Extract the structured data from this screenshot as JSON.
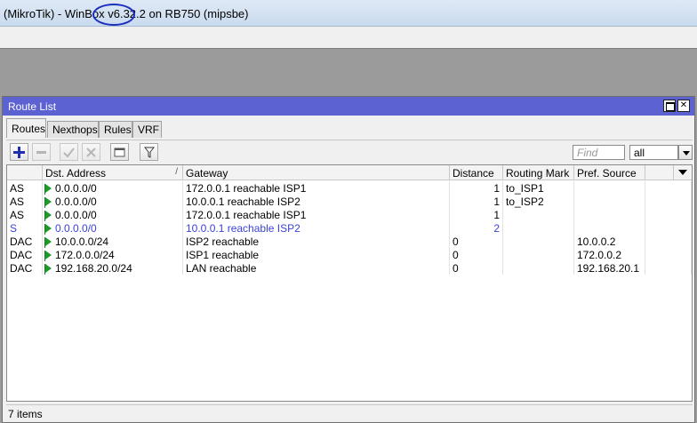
{
  "app": {
    "window_title": "(MikroTik) - WinBox v6.32.2 on RB750 (mipsbe)"
  },
  "route_list": {
    "title": "Route List",
    "tabs": [
      {
        "label": "Routes",
        "active": true
      },
      {
        "label": "Nexthops",
        "active": false
      },
      {
        "label": "Rules",
        "active": false
      },
      {
        "label": "VRF",
        "active": false
      }
    ],
    "toolbar": {
      "add_icon": "plus-icon",
      "remove_icon": "minus-icon",
      "enable_icon": "check-icon",
      "disable_icon": "x-icon",
      "comment_icon": "comment-icon",
      "filter_icon": "filter-icon",
      "find_placeholder": "Find",
      "filter_value": "all"
    },
    "columns": {
      "flags": "",
      "dst_address": "Dst. Address",
      "sort_indicator": "/",
      "gateway": "Gateway",
      "distance": "Distance",
      "routing_mark": "Routing Mark",
      "pref_source": "Pref. Source"
    },
    "rows": [
      {
        "flags": "AS",
        "dst": "0.0.0.0/0",
        "gateway": "172.0.0.1 reachable ISP1",
        "distance": "1",
        "mark": "to_ISP1",
        "pref": "",
        "num_align": "right",
        "blue": false,
        "flag_icon": true
      },
      {
        "flags": "AS",
        "dst": "0.0.0.0/0",
        "gateway": "10.0.0.1 reachable ISP2",
        "distance": "1",
        "mark": "to_ISP2",
        "pref": "",
        "num_align": "right",
        "blue": false,
        "flag_icon": true
      },
      {
        "flags": "AS",
        "dst": "0.0.0.0/0",
        "gateway": "172.0.0.1 reachable ISP1",
        "distance": "1",
        "mark": "",
        "pref": "",
        "num_align": "right",
        "blue": false,
        "flag_icon": true
      },
      {
        "flags": "S",
        "dst": "0.0.0.0/0",
        "gateway": "10.0.0.1 reachable ISP2",
        "distance": "2",
        "mark": "",
        "pref": "",
        "num_align": "right",
        "blue": true,
        "flag_icon": true
      },
      {
        "flags": "DAC",
        "dst": "10.0.0.0/24",
        "gateway": "ISP2 reachable",
        "distance": "0",
        "mark": "",
        "pref": "10.0.0.2",
        "num_align": "left",
        "blue": false,
        "flag_icon": true
      },
      {
        "flags": "DAC",
        "dst": "172.0.0.0/24",
        "gateway": "ISP1 reachable",
        "distance": "0",
        "mark": "",
        "pref": "172.0.0.2",
        "num_align": "left",
        "blue": false,
        "flag_icon": true
      },
      {
        "flags": "DAC",
        "dst": "192.168.20.0/24",
        "gateway": "LAN reachable",
        "distance": "0",
        "mark": "",
        "pref": "192.168.20.1",
        "num_align": "left",
        "blue": false,
        "flag_icon": true
      }
    ],
    "status": "7 items"
  },
  "colors": {
    "window_title_bg": "#5d62d3",
    "inactive_route_text": "#3b42d6",
    "active_flag": "#1e9a2a",
    "annotation_oval": "#1a2fbf"
  }
}
